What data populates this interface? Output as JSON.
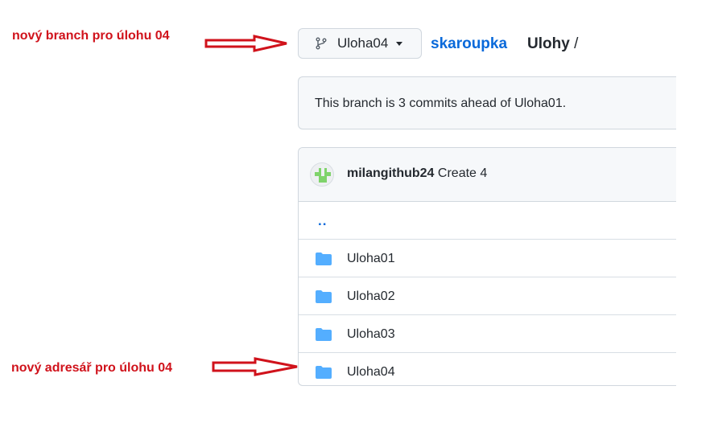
{
  "annotations": {
    "branch_note": "nový branch pro úlohu 04",
    "folder_note": "nový adresář pro úlohu 04",
    "color": "#d0121b"
  },
  "header": {
    "branch_icon": "git-branch-icon",
    "branch_name": "Uloha04",
    "owner": "skaroupka",
    "repo": "Ulohy",
    "separator": "/"
  },
  "branch_status": {
    "text": "This branch is 3 commits ahead of Uloha01."
  },
  "latest_commit": {
    "author": "milangithub24",
    "message": "Create 4"
  },
  "files": {
    "parent": "..",
    "items": [
      {
        "icon": "folder-icon",
        "name": "Uloha01"
      },
      {
        "icon": "folder-icon",
        "name": "Uloha02"
      },
      {
        "icon": "folder-icon",
        "name": "Uloha03"
      },
      {
        "icon": "folder-icon",
        "name": "Uloha04"
      }
    ]
  },
  "colors": {
    "link": "#0969da",
    "folder": "#54aeff",
    "border": "#d0d7de"
  }
}
